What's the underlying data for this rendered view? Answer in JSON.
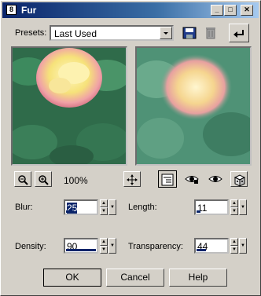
{
  "window": {
    "title": "Fur"
  },
  "presets": {
    "label": "Presets:",
    "value": "Last Used"
  },
  "zoom": {
    "level": "100%"
  },
  "params": {
    "blur": {
      "label": "Blur:",
      "value": "25"
    },
    "length": {
      "label": "Length:",
      "value": "11"
    },
    "density": {
      "label": "Density:",
      "value": "90"
    },
    "transparency": {
      "label": "Transparency:",
      "value": "44"
    }
  },
  "buttons": {
    "ok": "OK",
    "cancel": "Cancel",
    "help": "Help"
  },
  "icons": [
    "app-icon",
    "minimize-icon",
    "maximize-icon",
    "close-icon",
    "save-preset-icon",
    "delete-preset-icon",
    "reset-icon",
    "zoom-out-icon",
    "zoom-in-icon",
    "pan-icon",
    "preview-toggle-icon",
    "proof-icon",
    "auto-proof-icon",
    "randomize-icon"
  ]
}
